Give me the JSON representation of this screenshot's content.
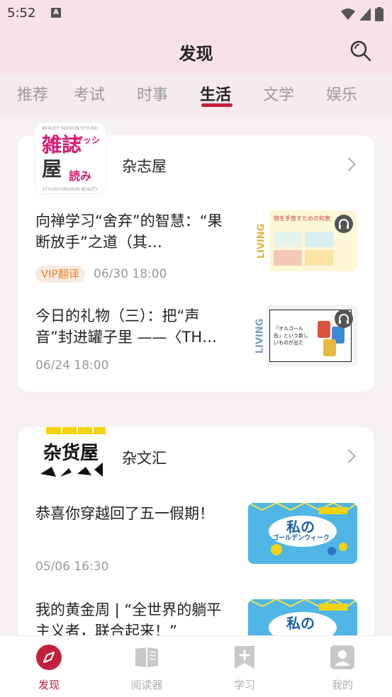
{
  "status": {
    "time": "5:52",
    "notif_icon": "a-letter-icon"
  },
  "header": {
    "title": "发现",
    "search_icon": "search-icon"
  },
  "tabs": [
    {
      "label": "推荐"
    },
    {
      "label": "考试"
    },
    {
      "label": "时事"
    },
    {
      "label": "生活",
      "active": true
    },
    {
      "label": "文学"
    },
    {
      "label": "娱乐"
    }
  ],
  "sections": [
    {
      "name": "杂志屋",
      "logo_text": {
        "line1": "雑誌",
        "line2": "屋",
        "kana": "ザッシ",
        "kana2": "読み"
      },
      "articles": [
        {
          "title": "向禅学习“舍弃”的智慧：“果断放手”之道（其…",
          "badge": "VIP翻译",
          "date": "06/30 18:00",
          "thumb_text": "LIVING",
          "thumb_caption": "物を手放すための知恵"
        },
        {
          "title": "今日的礼物（三）：把“声音”封进罐子里 ——〈TH…",
          "date": "06/24 18:00",
          "thumb_text": "LIVING",
          "thumb_caption": "「オルゴール缶」という新しいものが出た"
        }
      ]
    },
    {
      "name": "杂文汇",
      "logo_text": {
        "main": "杂货屋"
      },
      "articles": [
        {
          "title": "恭喜你穿越回了五一假期！",
          "date": "05/06 16:30",
          "thumb_text": "私の",
          "thumb_caption": "ゴールデンウィーク"
        },
        {
          "title": "我的黄金周 | “全世界的躺平主义者，联合起来！”",
          "thumb_text": "私の"
        }
      ]
    }
  ],
  "bottom_nav": [
    {
      "label": "发现",
      "icon": "compass-icon",
      "active": true
    },
    {
      "label": "阅读器",
      "icon": "book-icon"
    },
    {
      "label": "学习",
      "icon": "bookmark-plus-icon"
    },
    {
      "label": "我的",
      "icon": "profile-icon"
    }
  ],
  "colors": {
    "accent": "#c41f3e",
    "header_bg": "#f8e2e8",
    "vip_text": "#e28a2f"
  }
}
